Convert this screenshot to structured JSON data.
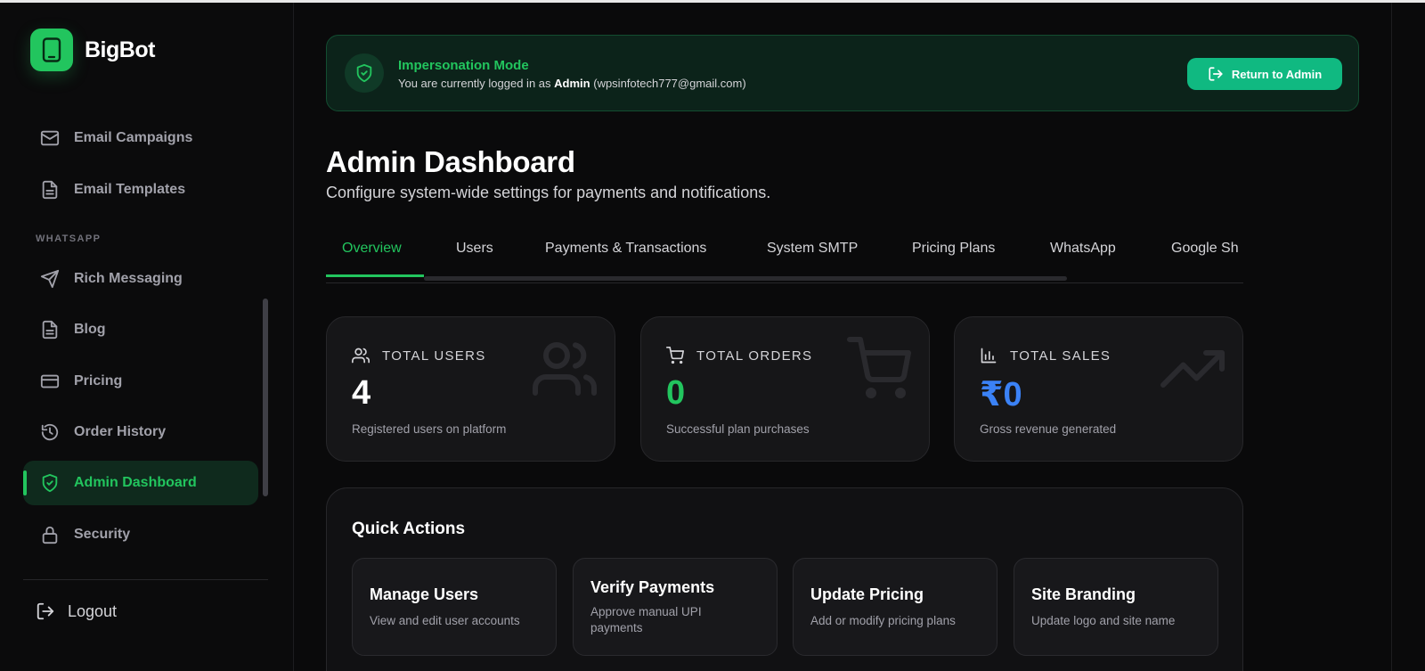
{
  "app": {
    "name": "BigBot"
  },
  "sidebar": {
    "section_whatsapp": "WHATSAPP",
    "items": [
      {
        "label": "Email Campaigns",
        "icon": "mail-icon"
      },
      {
        "label": "Email Templates",
        "icon": "file-text-icon"
      },
      {
        "label": "Rich Messaging",
        "icon": "send-icon"
      },
      {
        "label": "Blog",
        "icon": "file-text-icon"
      },
      {
        "label": "Pricing",
        "icon": "credit-card-icon"
      },
      {
        "label": "Order History",
        "icon": "history-icon"
      },
      {
        "label": "Admin Dashboard",
        "icon": "shield-check-icon",
        "active": true
      },
      {
        "label": "Security",
        "icon": "lock-icon"
      }
    ],
    "logout": "Logout"
  },
  "banner": {
    "title": "Impersonation Mode",
    "prefix": "You are currently logged in as",
    "user": "Admin",
    "email": "(wpsinfotech777@gmail.com)",
    "button": "Return to Admin"
  },
  "page": {
    "title": "Admin Dashboard",
    "subtitle": "Configure system-wide settings for payments and notifications."
  },
  "tabs": [
    "Overview",
    "Users",
    "Payments & Transactions",
    "System SMTP",
    "Pricing Plans",
    "WhatsApp",
    "Google Sh"
  ],
  "stats": [
    {
      "title": "TOTAL USERS",
      "value": "4",
      "desc": "Registered users on platform",
      "color": "#ffffff",
      "icon": "users-icon"
    },
    {
      "title": "TOTAL ORDERS",
      "value": "0",
      "desc": "Successful plan purchases",
      "color": "#22c55e",
      "icon": "cart-icon"
    },
    {
      "title": "TOTAL SALES",
      "value": "₹0",
      "desc": "Gross revenue generated",
      "color": "#3b82f6",
      "icon": "bar-chart-icon"
    }
  ],
  "quick_actions": {
    "title": "Quick Actions",
    "cards": [
      {
        "title": "Manage Users",
        "desc": "View and edit user accounts"
      },
      {
        "title": "Verify Payments",
        "desc": "Approve manual UPI payments"
      },
      {
        "title": "Update Pricing",
        "desc": "Add or modify pricing plans"
      },
      {
        "title": "Site Branding",
        "desc": "Update logo and site name"
      }
    ]
  },
  "colors": {
    "accent": "#22c55e",
    "button": "#10b981",
    "sales": "#3b82f6"
  }
}
